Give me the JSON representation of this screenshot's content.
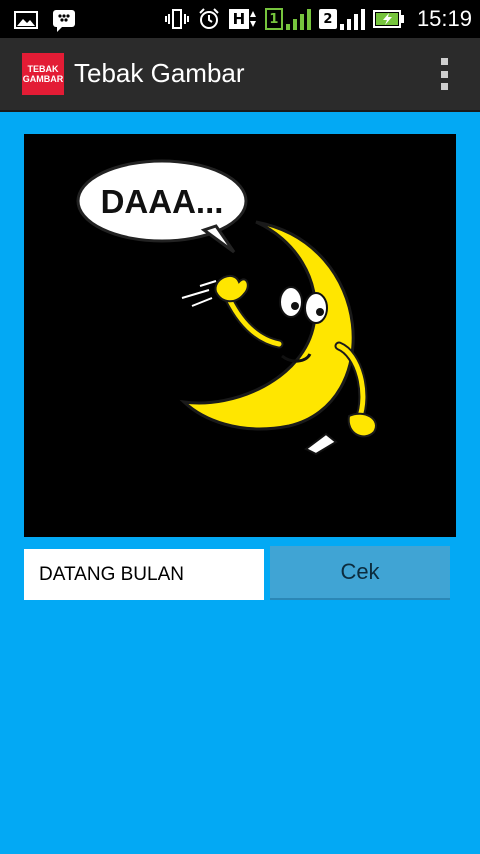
{
  "status_bar": {
    "time": "15:19",
    "sim1_label": "1",
    "sim2_label": "2",
    "network_label": "H"
  },
  "action_bar": {
    "app_icon_text_line1": "TEBAK",
    "app_icon_text_line2": "GAMBAR",
    "title": "Tebak Gambar"
  },
  "puzzle": {
    "bubble_text": "DAAA..."
  },
  "answer": {
    "value": "DATANG BULAN"
  },
  "check_button": {
    "label": "Cek"
  },
  "colors": {
    "background": "#03a9f4",
    "action_bar": "#2b2b2b",
    "button": "#40a4d4",
    "moon": "#ffe600"
  }
}
